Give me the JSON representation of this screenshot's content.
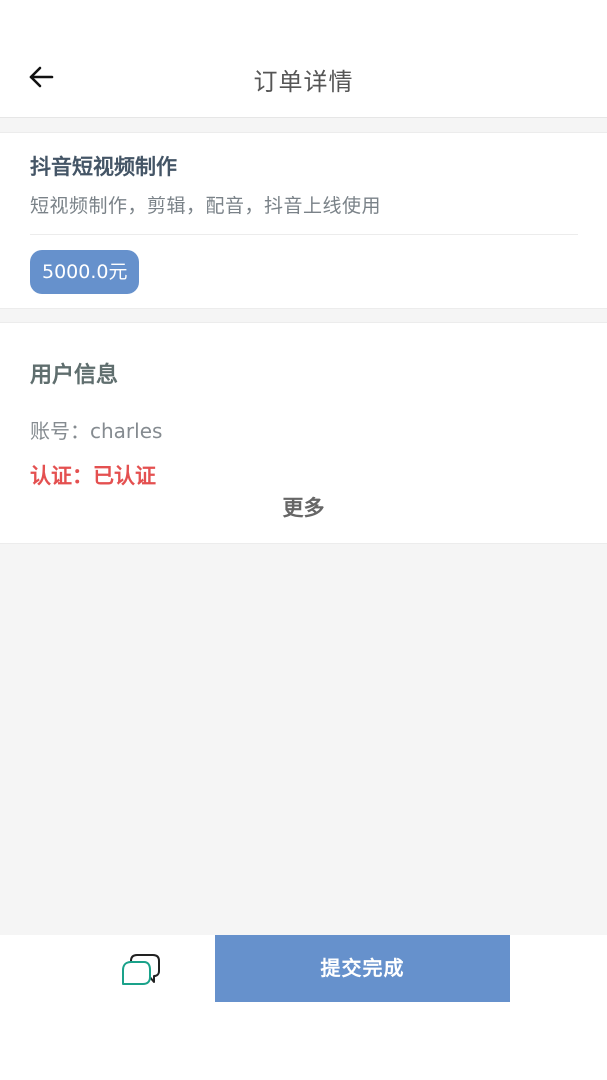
{
  "header": {
    "title": "订单详情",
    "back_icon": "arrow-left-icon"
  },
  "service": {
    "title": "抖音短视频制作",
    "description": "短视频制作，剪辑，配音，抖音上线使用",
    "price": "5000.0元"
  },
  "user_info": {
    "section_title": "用户信息",
    "account": "账号：charles",
    "verification": "认证：已认证",
    "more_label": "更多"
  },
  "bottom_bar": {
    "chat_icon": "chat-bubbles-icon",
    "submit_label": "提交完成"
  },
  "colors": {
    "accent": "#6691cc",
    "verified": "#e45050",
    "chat_icon": "#1aa28a"
  }
}
